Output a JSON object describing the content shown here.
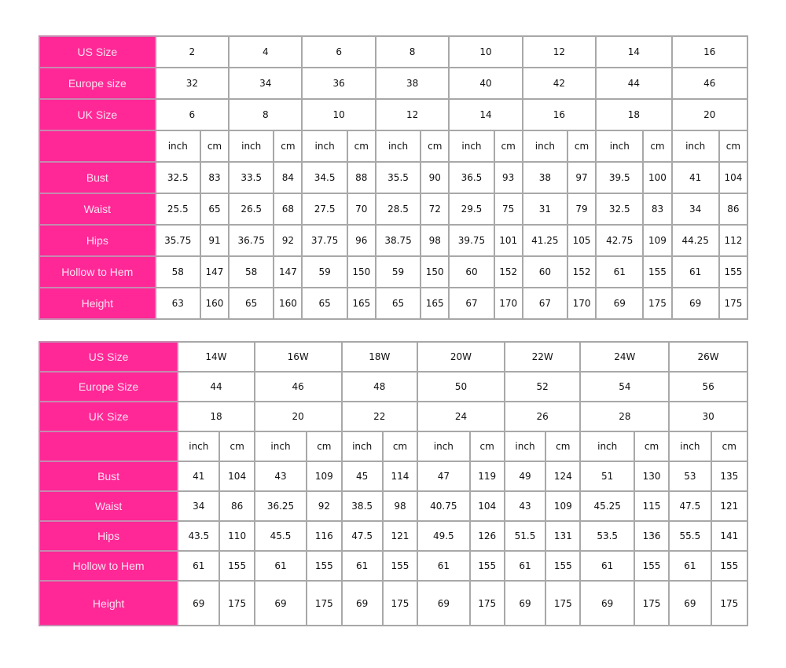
{
  "accent_color": "#ff2896",
  "tables": [
    {
      "id": "standard",
      "header_rows": [
        {
          "label": "US Size",
          "values": [
            "2",
            "4",
            "6",
            "8",
            "10",
            "12",
            "14",
            "16"
          ]
        },
        {
          "label": "Europe size",
          "values": [
            "32",
            "34",
            "36",
            "38",
            "40",
            "42",
            "44",
            "46"
          ]
        },
        {
          "label": "UK Size",
          "values": [
            "6",
            "8",
            "10",
            "12",
            "14",
            "16",
            "18",
            "20"
          ]
        }
      ],
      "units": [
        "inch",
        "cm"
      ],
      "measure_rows": [
        {
          "label": "Bust",
          "values": [
            "32.5",
            "83",
            "33.5",
            "84",
            "34.5",
            "88",
            "35.5",
            "90",
            "36.5",
            "93",
            "38",
            "97",
            "39.5",
            "100",
            "41",
            "104"
          ]
        },
        {
          "label": "Waist",
          "values": [
            "25.5",
            "65",
            "26.5",
            "68",
            "27.5",
            "70",
            "28.5",
            "72",
            "29.5",
            "75",
            "31",
            "79",
            "32.5",
            "83",
            "34",
            "86"
          ]
        },
        {
          "label": "Hips",
          "values": [
            "35.75",
            "91",
            "36.75",
            "92",
            "37.75",
            "96",
            "38.75",
            "98",
            "39.75",
            "101",
            "41.25",
            "105",
            "42.75",
            "109",
            "44.25",
            "112"
          ]
        },
        {
          "label": "Hollow to Hem",
          "values": [
            "58",
            "147",
            "58",
            "147",
            "59",
            "150",
            "59",
            "150",
            "60",
            "152",
            "60",
            "152",
            "61",
            "155",
            "61",
            "155"
          ]
        },
        {
          "label": "Height",
          "values": [
            "63",
            "160",
            "65",
            "160",
            "65",
            "165",
            "65",
            "165",
            "67",
            "170",
            "67",
            "170",
            "69",
            "175",
            "69",
            "175"
          ]
        }
      ]
    },
    {
      "id": "plus",
      "header_rows": [
        {
          "label": "US Size",
          "values": [
            "14W",
            "16W",
            "18W",
            "20W",
            "22W",
            "24W",
            "26W"
          ]
        },
        {
          "label": "Europe Size",
          "values": [
            "44",
            "46",
            "48",
            "50",
            "52",
            "54",
            "56"
          ]
        },
        {
          "label": "UK Size",
          "values": [
            "18",
            "20",
            "22",
            "24",
            "26",
            "28",
            "30"
          ]
        }
      ],
      "units": [
        "inch",
        "cm"
      ],
      "measure_rows": [
        {
          "label": "Bust",
          "values": [
            "41",
            "104",
            "43",
            "109",
            "45",
            "114",
            "47",
            "119",
            "49",
            "124",
            "51",
            "130",
            "53",
            "135"
          ]
        },
        {
          "label": "Waist",
          "values": [
            "34",
            "86",
            "36.25",
            "92",
            "38.5",
            "98",
            "40.75",
            "104",
            "43",
            "109",
            "45.25",
            "115",
            "47.5",
            "121"
          ]
        },
        {
          "label": "Hips",
          "values": [
            "43.5",
            "110",
            "45.5",
            "116",
            "47.5",
            "121",
            "49.5",
            "126",
            "51.5",
            "131",
            "53.5",
            "136",
            "55.5",
            "141"
          ]
        },
        {
          "label": "Hollow to Hem",
          "values": [
            "61",
            "155",
            "61",
            "155",
            "61",
            "155",
            "61",
            "155",
            "61",
            "155",
            "61",
            "155",
            "61",
            "155"
          ]
        },
        {
          "label": "Height",
          "values": [
            "69",
            "175",
            "69",
            "175",
            "69",
            "175",
            "69",
            "175",
            "69",
            "175",
            "69",
            "175",
            "69",
            "175"
          ]
        }
      ]
    }
  ]
}
